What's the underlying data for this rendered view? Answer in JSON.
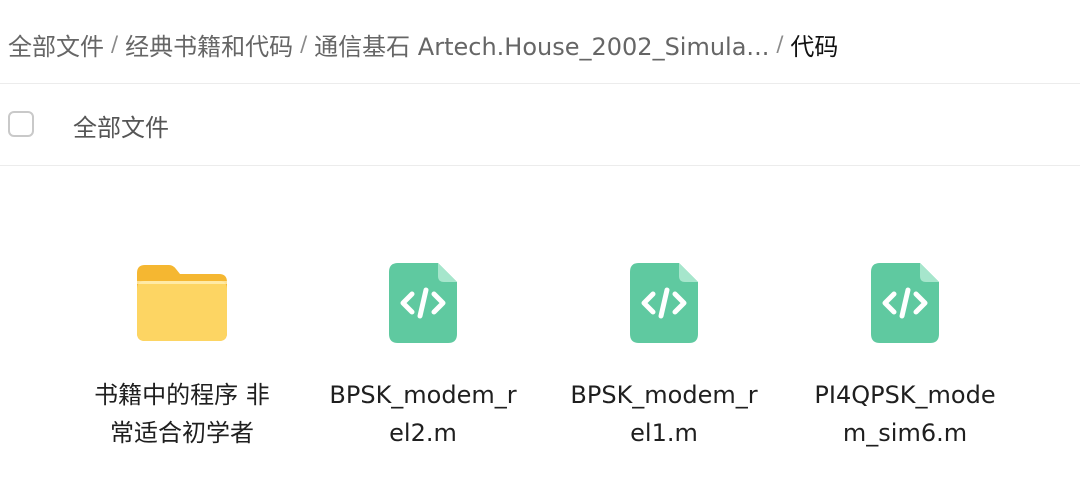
{
  "breadcrumb": {
    "items": [
      "全部文件",
      "经典书籍和代码",
      "通信基石 Artech.House_2002_Simula...",
      "代码"
    ],
    "separator": "/"
  },
  "selection": {
    "label": "全部文件"
  },
  "files": [
    {
      "name": "书籍中的程序 非常适合初学者",
      "type": "folder",
      "icon": "folder-icon"
    },
    {
      "name": "BPSK_modem_rel2.m",
      "type": "code",
      "icon": "code-file-icon"
    },
    {
      "name": "BPSK_modem_rel1.m",
      "type": "code",
      "icon": "code-file-icon"
    },
    {
      "name": "PI4QPSK_modem_sim6.m",
      "type": "code",
      "icon": "code-file-icon"
    }
  ],
  "colors": {
    "folder": "#fcc74a",
    "code_file": "#5fc9a0",
    "text": "#1f1f1f",
    "muted": "#666666"
  }
}
